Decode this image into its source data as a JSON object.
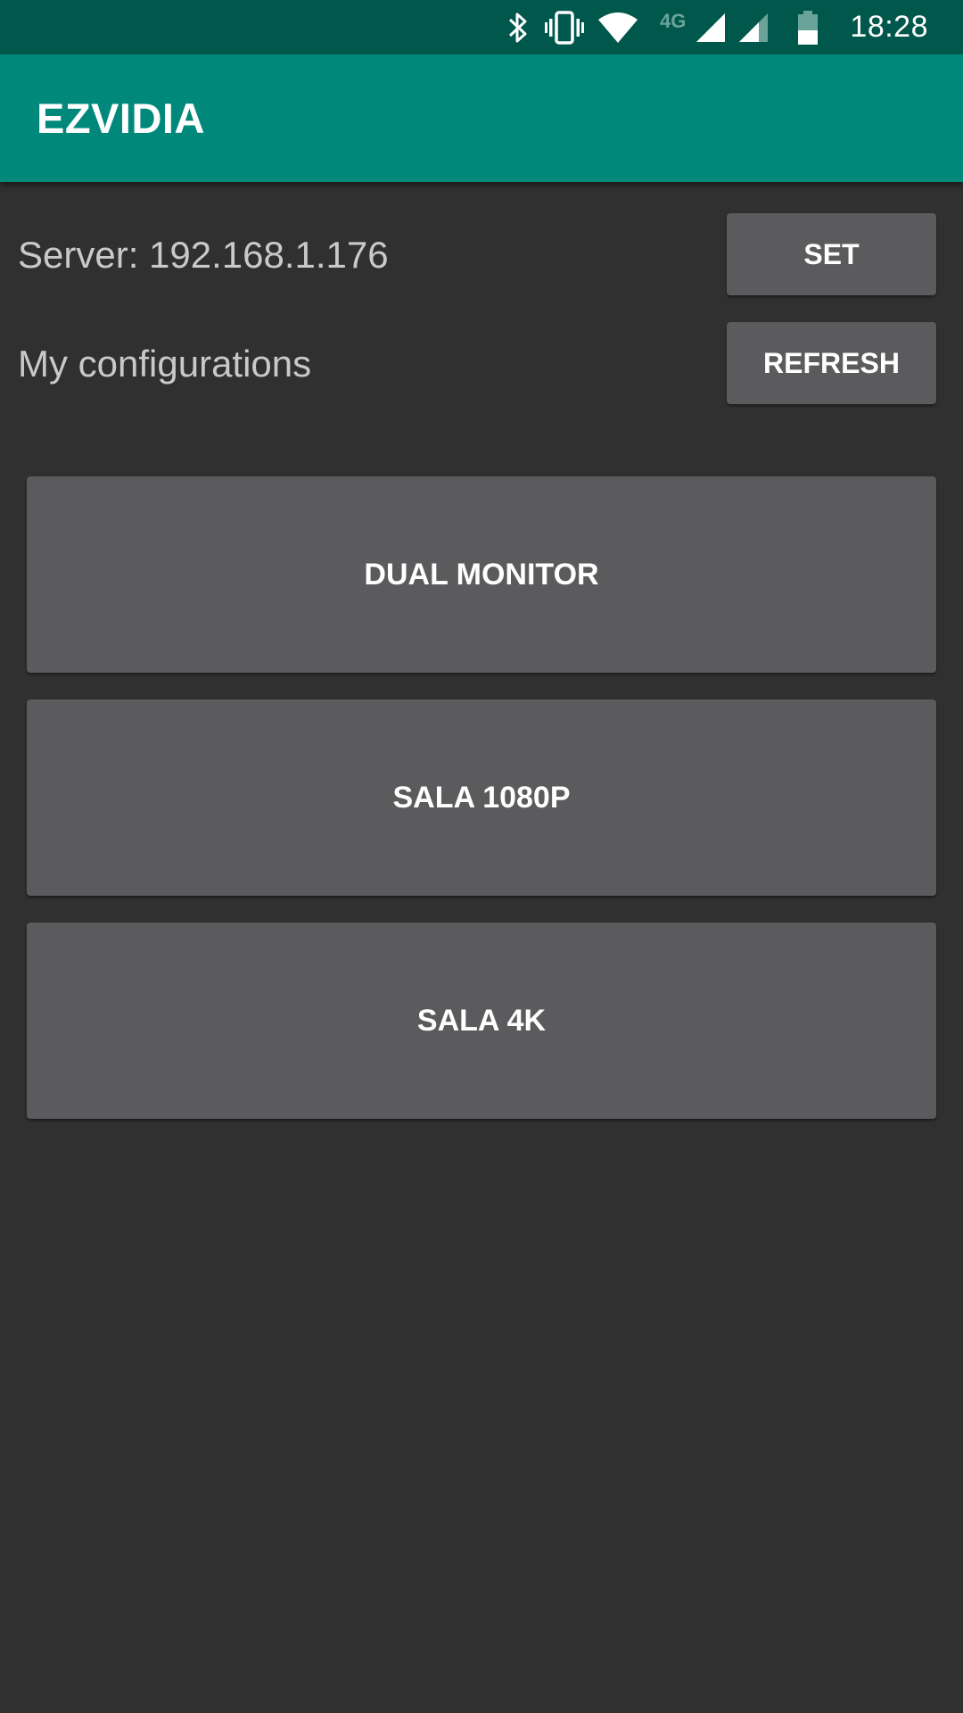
{
  "status_bar": {
    "network_type": "4G",
    "time": "18:28",
    "icons": [
      "bluetooth-icon",
      "vibrate-icon",
      "wifi-icon",
      "signal-icon",
      "signal-icon",
      "battery-icon"
    ]
  },
  "app_bar": {
    "title": "EZVIDIA",
    "color": "#00897b"
  },
  "server": {
    "label": "Server: 192.168.1.176",
    "button_label": "SET"
  },
  "configurations": {
    "label": "My configurations",
    "refresh_label": "REFRESH",
    "items": [
      {
        "label": "DUAL MONITOR"
      },
      {
        "label": "SALA 1080P"
      },
      {
        "label": "SALA 4K"
      }
    ]
  },
  "colors": {
    "background": "#303030",
    "status_bar": "#00574b",
    "button": "#5b5b5d"
  }
}
